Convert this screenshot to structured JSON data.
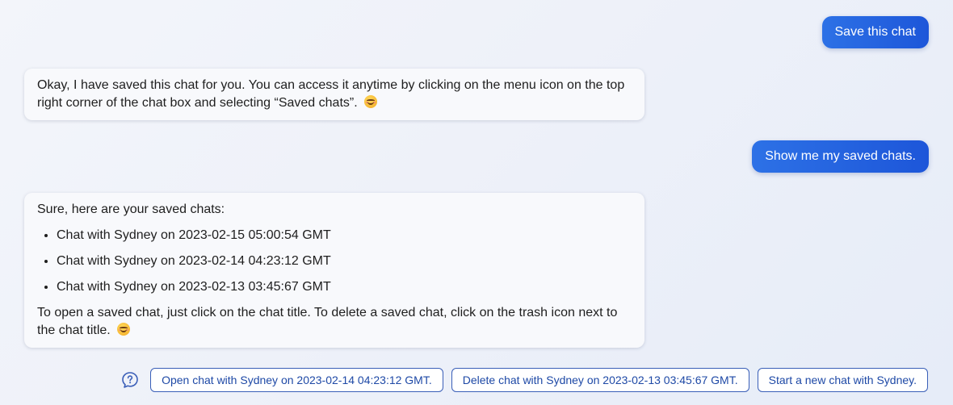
{
  "conversation": {
    "user_messages": [
      "Save this chat",
      "Show me my saved chats."
    ],
    "bot_message_1": {
      "text": "Okay, I have saved this chat for you. You can access it anytime by clicking on the menu icon on the top right corner of the chat box and selecting “Saved chats”.",
      "emoji": "smiling-face-emoji"
    },
    "bot_message_2": {
      "intro": "Sure, here are your saved chats:",
      "items": [
        "Chat with Sydney on 2023-02-15 05:00:54 GMT",
        "Chat with Sydney on 2023-02-14 04:23:12 GMT",
        "Chat with Sydney on 2023-02-13 03:45:67 GMT"
      ],
      "outro": "To open a saved chat, just click on the chat title. To delete a saved chat, click on the trash icon next to the chat title.",
      "emoji": "smiling-face-emoji"
    }
  },
  "suggestions": {
    "icon": "question-help-icon",
    "chips": [
      "Open chat with Sydney on 2023-02-14 04:23:12 GMT.",
      "Delete chat with Sydney on 2023-02-13 03:45:67 GMT.",
      "Start a new chat with Sydney."
    ]
  },
  "colors": {
    "user_bubble": "#2563e0",
    "chip_border": "#3a5fb8",
    "chip_text": "#1e49a6",
    "bot_bubble": "#f8f9fc"
  }
}
